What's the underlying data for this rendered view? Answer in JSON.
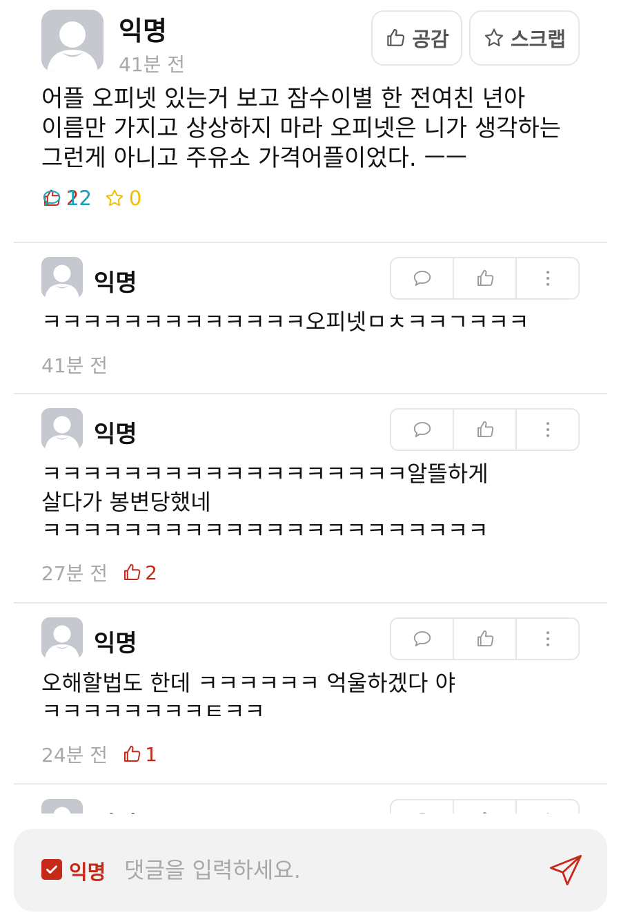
{
  "post": {
    "author": "익명",
    "time": "41분 전",
    "like_button": "공감",
    "scrap_button": "스크랩",
    "body_lines": [
      "어플 오피넷 있는거 보고 잠수이별 한 전여친 년아",
      "이름만 가지고 상상하지 마라 오피넷은 니가 생각하는",
      "그런게 아니고 주유소 가격어플이었다. ㅡㅡ"
    ],
    "likes": "22",
    "comments": "12",
    "scraps": "0"
  },
  "comments": [
    {
      "author": "익명",
      "lines": [
        "ㅋㅋㅋㅋㅋㅋㅋㅋㅋㅋㅋㅋㅋ오피넷ㅁㅊㅋㅋㄱㅋㅋㅋ"
      ],
      "time": "41분 전",
      "votes": ""
    },
    {
      "author": "익명",
      "lines": [
        "ㅋㅋㅋㅋㅋㅋㅋㅋㅋㅋㅋㅋㅋㅋㅋㅋㅋㅋ알뜰하게",
        "살다가 봉변당했네",
        "ㅋㅋㅋㅋㅋㅋㅋㅋㅋㅋㅋㅋㅋㅋㅋㅋㅋㅋㅋㅋㅋㅋ"
      ],
      "time": "27분 전",
      "votes": "2"
    },
    {
      "author": "익명",
      "lines": [
        "오해할법도 한데 ㅋㅋㅋㅋㅋㅋ 억울하겠다 야",
        "ㅋㅋㅋㅋㅋㅋㅋㅋㅌㅋㅋ"
      ],
      "time": "24분 전",
      "votes": "1"
    },
    {
      "author": "익명",
      "lines": [],
      "time": "",
      "votes": ""
    }
  ],
  "input": {
    "anonymous_label": "익명",
    "placeholder": "댓글을 입력하세요."
  },
  "colors": {
    "accent_red": "#c62917",
    "comment_teal": "#12a6c0",
    "scrap_yellow": "#f0bd00",
    "muted_gray": "#a8a8a8"
  },
  "icons": {
    "like": "thumbs-up-icon",
    "comment": "speech-bubble-icon",
    "scrap": "star-icon",
    "more": "kebab-menu-icon",
    "send": "paper-plane-icon",
    "check": "checkbox-check-icon",
    "avatar": "default-avatar-icon"
  }
}
